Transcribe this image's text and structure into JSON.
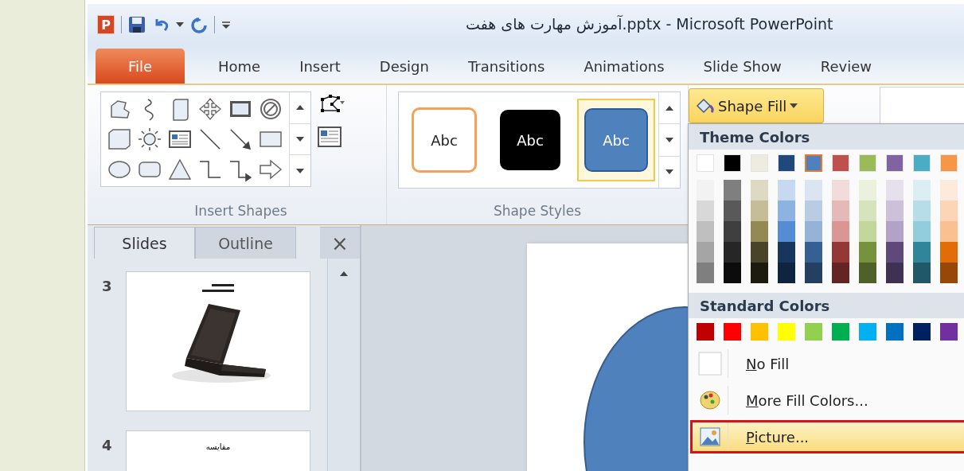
{
  "title_bar": {
    "logo": "P",
    "title": "آموزش مهارت های هفت.pptx  -  Microsoft PowerPoint"
  },
  "tabs": [
    {
      "label": "File",
      "kind": "file",
      "selected": false
    },
    {
      "label": "Home",
      "kind": "tab",
      "selected": false
    },
    {
      "label": "Insert",
      "kind": "tab",
      "selected": false
    },
    {
      "label": "Design",
      "kind": "tab",
      "selected": false
    },
    {
      "label": "Transitions",
      "kind": "tab",
      "selected": false
    },
    {
      "label": "Animations",
      "kind": "tab",
      "selected": false
    },
    {
      "label": "Slide Show",
      "kind": "tab",
      "selected": false
    },
    {
      "label": "Review",
      "kind": "tab",
      "selected": false
    }
  ],
  "ribbon": {
    "insert_shapes": {
      "label": "Insert Shapes"
    },
    "shape_styles": {
      "label": "Shape Styles",
      "styles": [
        {
          "label": "Abc",
          "kind": "outline",
          "selected": false
        },
        {
          "label": "Abc",
          "kind": "dark",
          "selected": false
        },
        {
          "label": "Abc",
          "kind": "accent",
          "selected": true
        }
      ]
    },
    "shape_fill": {
      "label": "Shape Fill",
      "expanded": true
    }
  },
  "slides_pane": {
    "tabs": [
      {
        "label": "Slides",
        "selected": true
      },
      {
        "label": "Outline",
        "selected": false
      }
    ],
    "close": "×",
    "slides": [
      {
        "number": "3",
        "kind": "picture"
      },
      {
        "number": "4",
        "kind": "title",
        "title": "مقایسه"
      }
    ]
  },
  "fill_menu": {
    "theme_header": "Theme Colors",
    "theme_colors": [
      {
        "color": "#ffffff",
        "selected": false,
        "shades": [
          {
            "color": "#f2f2f2"
          },
          {
            "color": "#d8d8d8"
          },
          {
            "color": "#bfbfbf"
          },
          {
            "color": "#a5a5a5"
          },
          {
            "color": "#7f7f7f"
          }
        ]
      },
      {
        "color": "#000000",
        "selected": false,
        "shades": [
          {
            "color": "#7f7f7f"
          },
          {
            "color": "#595959"
          },
          {
            "color": "#3f3f3f"
          },
          {
            "color": "#262626"
          },
          {
            "color": "#0c0c0c"
          }
        ]
      },
      {
        "color": "#eeece1",
        "selected": false,
        "shades": [
          {
            "color": "#ddd9c3"
          },
          {
            "color": "#c4bd97"
          },
          {
            "color": "#938953"
          },
          {
            "color": "#494429"
          },
          {
            "color": "#1d1b10"
          }
        ]
      },
      {
        "color": "#1f497d",
        "selected": false,
        "shades": [
          {
            "color": "#c6d9f0"
          },
          {
            "color": "#8db3e2"
          },
          {
            "color": "#548dd4"
          },
          {
            "color": "#17365d"
          },
          {
            "color": "#0f243e"
          }
        ]
      },
      {
        "color": "#4f81bd",
        "selected": true,
        "shades": [
          {
            "color": "#dbe5f1"
          },
          {
            "color": "#b8cce4"
          },
          {
            "color": "#95b3d7"
          },
          {
            "color": "#366092"
          },
          {
            "color": "#244061"
          }
        ]
      },
      {
        "color": "#c0504d",
        "selected": false,
        "shades": [
          {
            "color": "#f2dcdb"
          },
          {
            "color": "#e5b9b7"
          },
          {
            "color": "#d99694"
          },
          {
            "color": "#953734"
          },
          {
            "color": "#632423"
          }
        ]
      },
      {
        "color": "#9bbb59",
        "selected": false,
        "shades": [
          {
            "color": "#ebf1dd"
          },
          {
            "color": "#d7e3bc"
          },
          {
            "color": "#c3d69b"
          },
          {
            "color": "#76923c"
          },
          {
            "color": "#4f6128"
          }
        ]
      },
      {
        "color": "#8064a2",
        "selected": false,
        "shades": [
          {
            "color": "#e5e0ec"
          },
          {
            "color": "#ccc1d9"
          },
          {
            "color": "#b2a2c7"
          },
          {
            "color": "#5f497a"
          },
          {
            "color": "#3f3151"
          }
        ]
      },
      {
        "color": "#4bacc6",
        "selected": false,
        "shades": [
          {
            "color": "#dbeef3"
          },
          {
            "color": "#b7dde8"
          },
          {
            "color": "#92cddc"
          },
          {
            "color": "#31859b"
          },
          {
            "color": "#205867"
          }
        ]
      },
      {
        "color": "#f79646",
        "selected": false,
        "shades": [
          {
            "color": "#fdeada"
          },
          {
            "color": "#fbd5b5"
          },
          {
            "color": "#fac08f"
          },
          {
            "color": "#e36c09"
          },
          {
            "color": "#974806"
          }
        ]
      }
    ],
    "standard_header": "Standard Colors",
    "standard_colors": [
      {
        "color": "#c00000"
      },
      {
        "color": "#ff0000"
      },
      {
        "color": "#ffc000"
      },
      {
        "color": "#ffff00"
      },
      {
        "color": "#92d050"
      },
      {
        "color": "#00b050"
      },
      {
        "color": "#00b0f0"
      },
      {
        "color": "#0070c0"
      },
      {
        "color": "#002060"
      },
      {
        "color": "#7030a0"
      }
    ],
    "items": [
      {
        "label": "No Fill",
        "kind": "none",
        "selected": false
      },
      {
        "label": "More Fill Colors...",
        "kind": "palette",
        "selected": false
      },
      {
        "label": "Picture...",
        "kind": "picture",
        "selected": true
      }
    ]
  }
}
